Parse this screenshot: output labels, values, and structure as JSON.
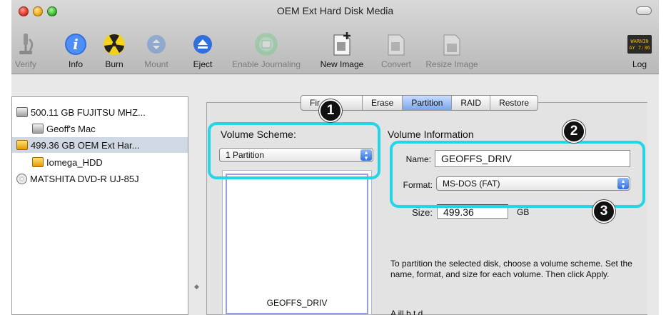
{
  "window": {
    "title": "OEM Ext Hard Disk Media"
  },
  "toolbar": {
    "verify": "Verify",
    "info": "Info",
    "burn": "Burn",
    "mount": "Mount",
    "eject": "Eject",
    "enable_journaling": "Enable Journaling",
    "new_image": "New Image",
    "convert": "Convert",
    "resize_image": "Resize Image",
    "log": "Log",
    "log_icon_text": "WARNIN\nAY 7:36"
  },
  "sidebar": {
    "items": [
      {
        "label": "500.11 GB FUJITSU MHZ...",
        "icon": "drive-icon"
      },
      {
        "label": "Geoff's Mac",
        "icon": "volume-icon"
      },
      {
        "label": "499.36 GB OEM Ext Har...",
        "icon": "external-drive-icon",
        "selected": true
      },
      {
        "label": "Iomega_HDD",
        "icon": "external-volume-icon"
      },
      {
        "label": "MATSHITA DVD-R UJ-85J",
        "icon": "optical-disc-icon"
      }
    ]
  },
  "tabs": [
    "Fir    d",
    "Erase",
    "Partition",
    "RAID",
    "Restore"
  ],
  "partition": {
    "scheme_label": "Volume Scheme:",
    "scheme_value": "1 Partition",
    "preview_name": "GEOFFS_DRIV",
    "volume_info_label": "Volume Information",
    "name_label": "Name:",
    "name_value": "GEOFFS_DRIV",
    "format_label": "Format:",
    "format_value": "MS-DOS (FAT)",
    "size_label": "Size:",
    "size_value": "499.36",
    "size_unit": "GB",
    "help_text": "To partition the selected disk, choose a volume scheme. Set the name, format, and size for each volume. Then click Apply.",
    "help_text_2": "A                       ill b     t  d"
  },
  "callouts": [
    "1",
    "2",
    "3"
  ],
  "colors": {
    "callout": "#22d6e6",
    "selection": "#d0d8e3",
    "active_tab": "#7aa6e8"
  }
}
